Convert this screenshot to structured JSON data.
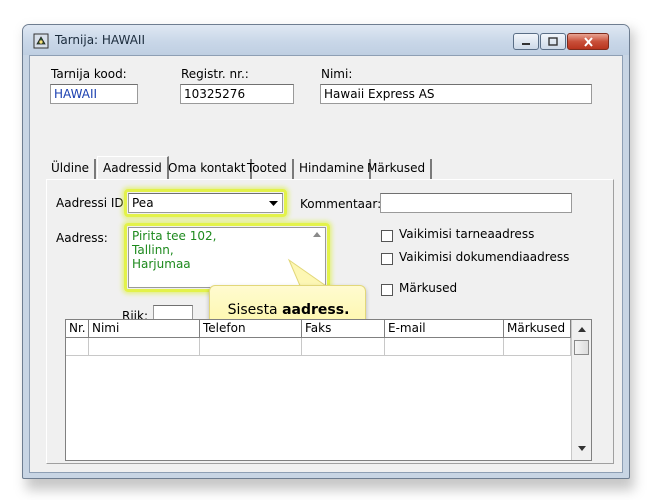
{
  "window": {
    "title": "Tarnija: HAWAII"
  },
  "header_fields": {
    "supplier_code": {
      "label": "Tarnija kood:",
      "value": "HAWAII"
    },
    "reg_no": {
      "label": "Registr. nr.:",
      "value": "10325276"
    },
    "name": {
      "label": "Nimi:",
      "value": "Hawaii Express AS"
    }
  },
  "tabs": [
    "Üldine",
    "Aadressid",
    "Oma kontakt",
    "Tooted",
    "Hindamine",
    "Märkused"
  ],
  "active_tab": "Aadressid",
  "address_form": {
    "address_id_label": "Aadressi ID:",
    "address_id_value": "Pea",
    "comment_label": "Kommentaar:",
    "comment_value": "",
    "address_label": "Aadress:",
    "address_lines": [
      "Pirita tee 102,",
      "Tallinn,",
      "Harjumaa"
    ],
    "country_label": "Riik:",
    "country_value": "",
    "checkboxes": [
      {
        "label": "Vaikimisi tarneaadress",
        "checked": false
      },
      {
        "label": "Vaikimisi dokumendiaadress",
        "checked": false
      },
      {
        "label": "Märkused",
        "checked": false
      }
    ]
  },
  "grid": {
    "columns": [
      "Nr.",
      "Nimi",
      "Telefon",
      "Faks",
      "E-mail",
      "Märkused"
    ],
    "rows": []
  },
  "callout": {
    "text_prefix": "Sisesta ",
    "text_bold": "aadress.",
    "text_suffix": ""
  },
  "colors": {
    "address_text": "#1e8a1e",
    "supplier_code_text": "#1a3fb0",
    "highlight": "#e3f24a"
  }
}
